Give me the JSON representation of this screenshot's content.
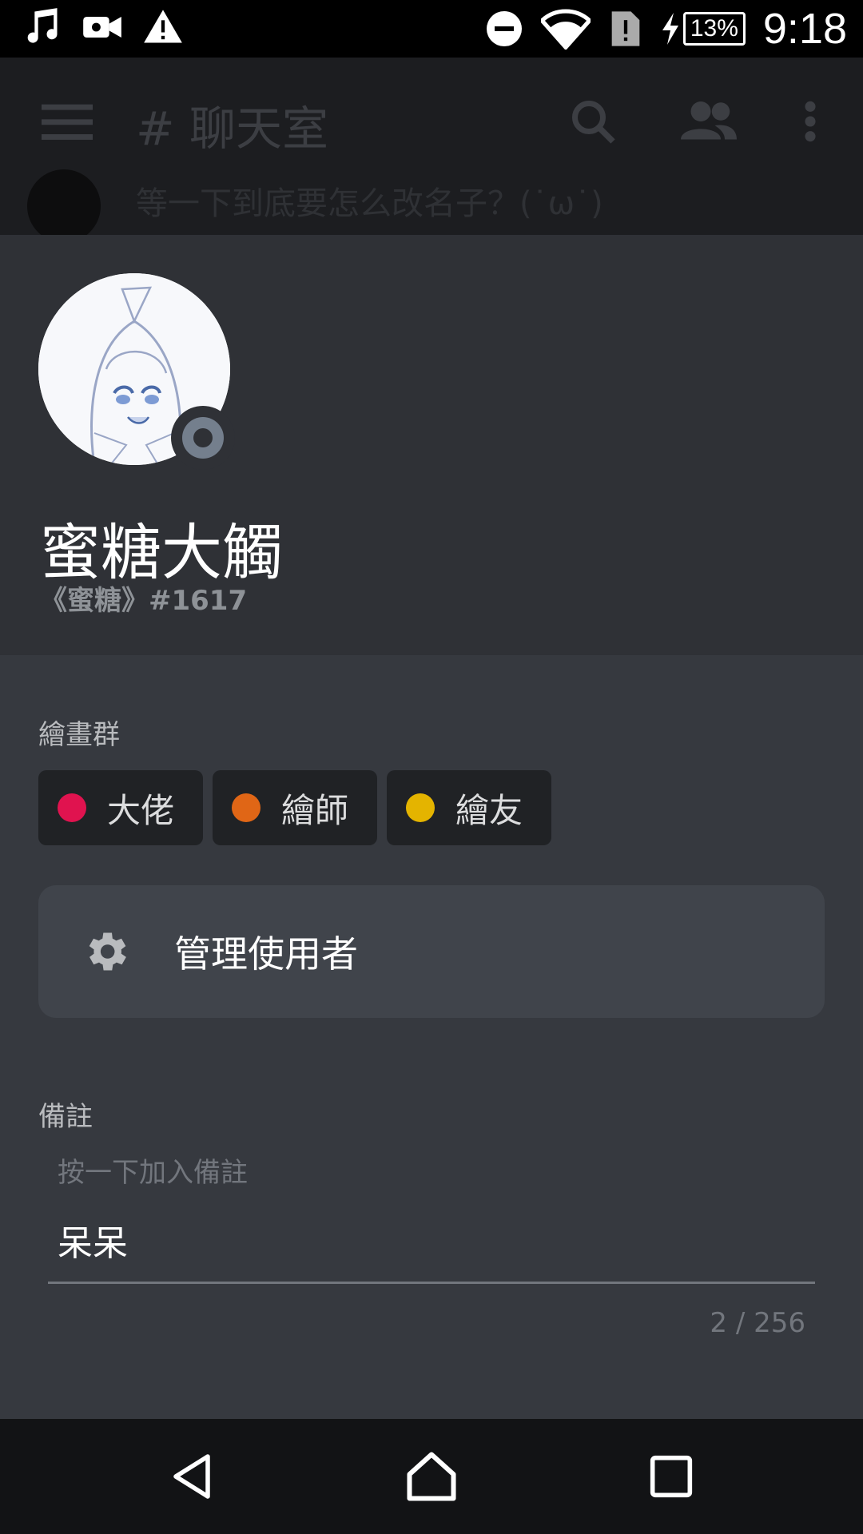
{
  "status_bar": {
    "time": "9:18",
    "battery": "13%",
    "icons_left": [
      "music-icon",
      "video-camera-icon",
      "warning-icon"
    ],
    "icons_right": [
      "do-not-disturb-icon",
      "wifi-icon",
      "sim-alert-icon",
      "charging-icon",
      "battery-icon"
    ]
  },
  "background_chat": {
    "channel_title": "# 聊天室",
    "snippet": "等一下到底要怎么改名子？(˙ω˙)"
  },
  "profile": {
    "display_name": "蜜糖大觸",
    "tag": "《蜜糖》#1617",
    "status": "offline"
  },
  "roles_section": {
    "label": "繪畫群",
    "roles": [
      {
        "name": "大佬",
        "color": "#e0134f"
      },
      {
        "name": "繪師",
        "color": "#e06616"
      },
      {
        "name": "繪友",
        "color": "#e4b400"
      }
    ]
  },
  "manage": {
    "label": "管理使用者"
  },
  "note": {
    "label": "備註",
    "placeholder": "按一下加入備註",
    "value": "呆呆",
    "counter": "2 / 256"
  },
  "colors": {
    "panel_bg": "#36393f",
    "header_bg": "#2f3136",
    "role_chip_bg": "#202225",
    "button_bg": "#40444b"
  }
}
